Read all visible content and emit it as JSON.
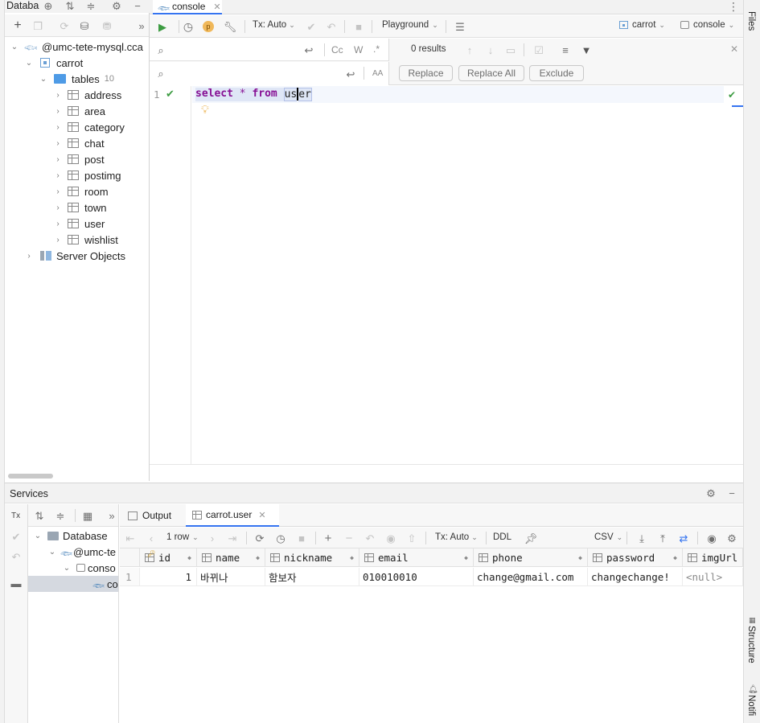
{
  "db_panel": {
    "title": "Databa",
    "tree": {
      "connection": "@umc-tete-mysql.cca",
      "schema": "carrot",
      "tables_label": "tables",
      "tables_count": "10",
      "tables": [
        "address",
        "area",
        "category",
        "chat",
        "post",
        "postimg",
        "room",
        "town",
        "user",
        "wishlist"
      ],
      "server_objects": "Server Objects"
    }
  },
  "editor": {
    "tab_label": "console",
    "toolbar": {
      "tx_mode": "Tx: Auto",
      "playground": "Playground",
      "schema_selector": "carrot",
      "session_selector": "console"
    },
    "find": {
      "results": "0 results",
      "case_btn": "Cc",
      "word_btn": "W",
      "regex_btn": ".*",
      "preserve_case": "AA",
      "replace": "Replace",
      "replace_all": "Replace All",
      "exclude": "Exclude"
    },
    "line_number": "1",
    "code": {
      "kw_select": "select",
      "op": "*",
      "kw_from": "from",
      "ident_a": "us",
      "ident_b": "er"
    }
  },
  "services": {
    "title": "Services",
    "tree": {
      "root": "Database",
      "connection": "@umc-te",
      "console": "conso",
      "session": "co"
    },
    "tabs": {
      "output": "Output",
      "result": "carrot.user"
    },
    "grid_toolbar": {
      "rows": "1 row",
      "tx_mode": "Tx: Auto",
      "ddl": "DDL",
      "format": "CSV"
    },
    "columns": [
      "id",
      "name",
      "nickname",
      "email",
      "phone",
      "password",
      "imgUrl"
    ],
    "rows": [
      {
        "row_num": "1",
        "cells": [
          "1",
          "바뀌나",
          "함보자",
          "010010010",
          "change@gmail.com",
          "changechange!",
          "<null>"
        ]
      }
    ]
  },
  "right_strip": {
    "files": "Files",
    "structure": "Structure",
    "notifications": "Notifi"
  },
  "colors": {
    "keyword": "#0033b3",
    "keyword_purple": "#871094",
    "selection": "#dfe6f6",
    "run_green": "#3d9c42",
    "folder_blue": "#4e9be6"
  }
}
